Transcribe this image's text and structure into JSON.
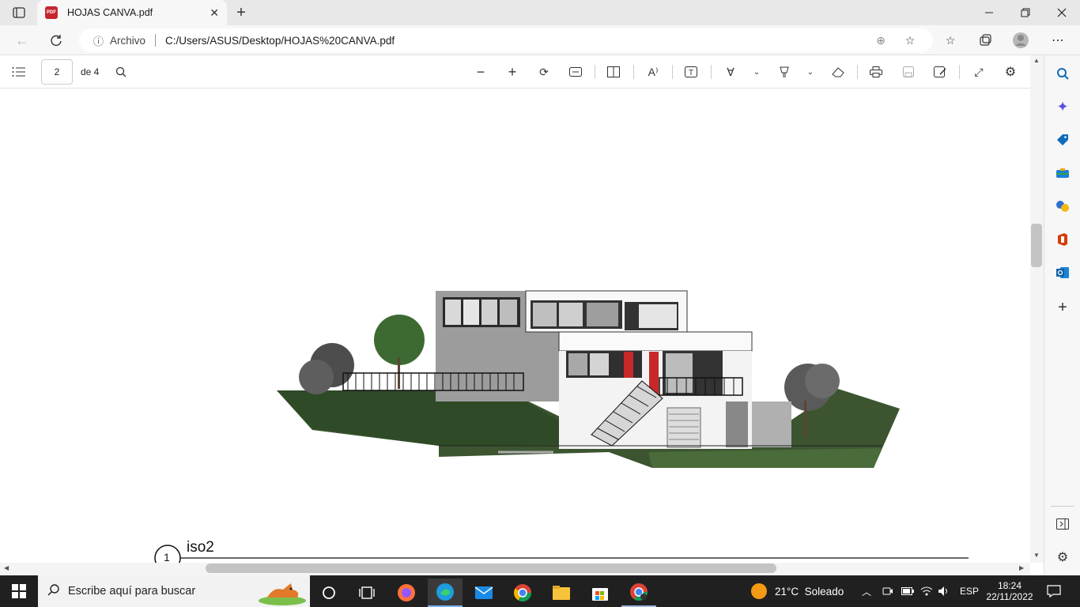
{
  "browser": {
    "tab": {
      "title": "HOJAS CANVA.pdf",
      "icon_text": "PDF"
    },
    "address": {
      "security_label": "Archivo",
      "url": "C:/Users/ASUS/Desktop/HOJAS%20CANVA.pdf"
    }
  },
  "pdf_toolbar": {
    "current_page": "2",
    "total_pages": "de 4"
  },
  "document": {
    "view_number": "1",
    "view_title": "iso2"
  },
  "taskbar": {
    "search_placeholder": "Escribe aquí para buscar",
    "weather": "21°C  Soleado",
    "language": "ESP",
    "time": "18:24",
    "date": "22/11/2022"
  },
  "colors": {
    "accent": "#0f6cbd",
    "taskbar": "#202020"
  }
}
